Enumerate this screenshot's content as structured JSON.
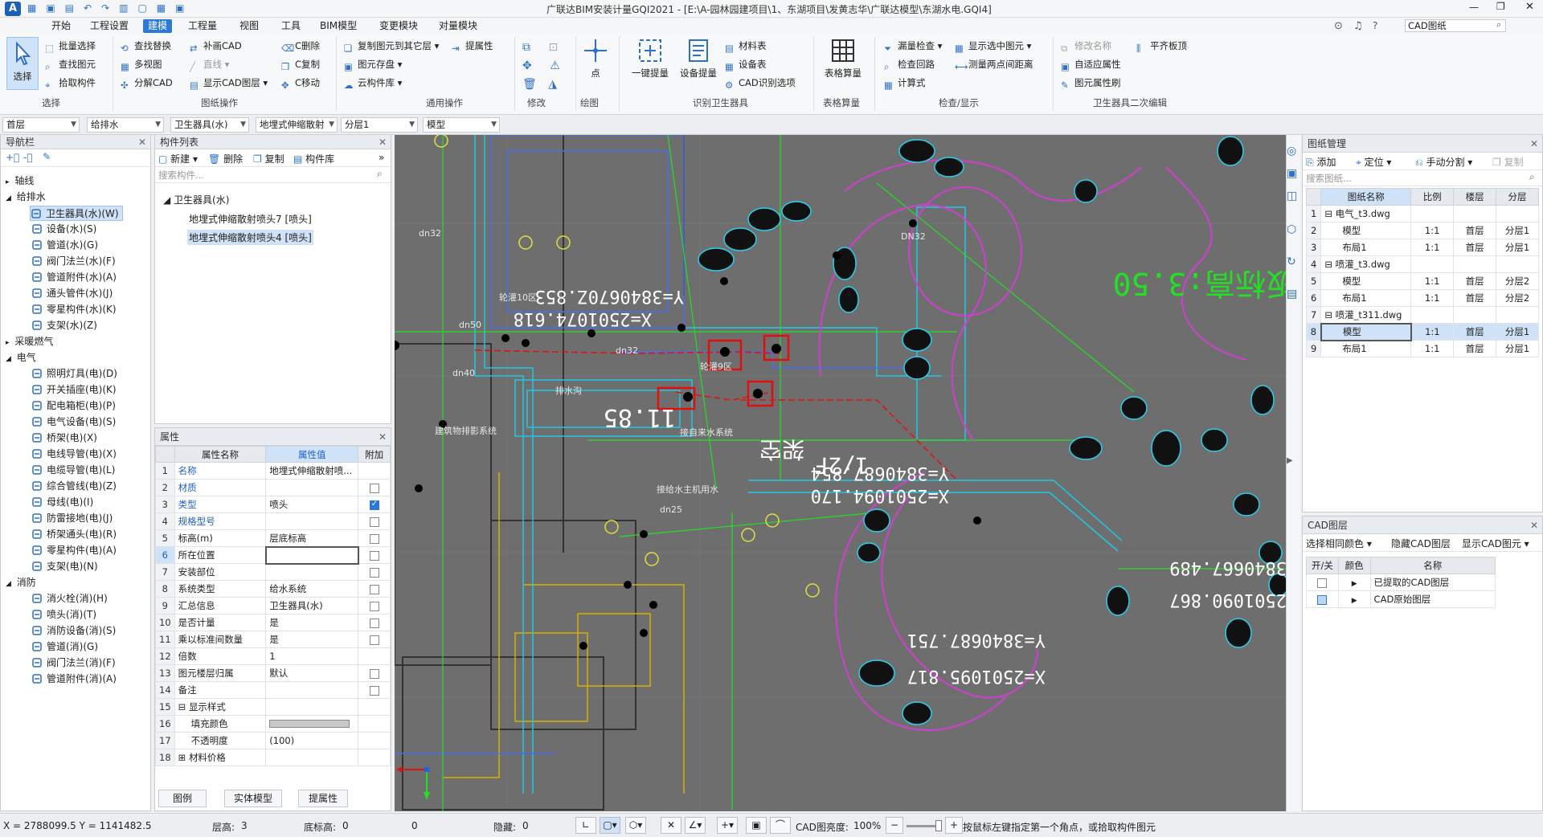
{
  "window": {
    "title": "广联达BIM安装计量GQI2021 - [E:\\A-园林园建项目\\1、东湖项目\\发黄志华\\广联达模型\\东湖水电.GQI4]",
    "search_placeholder": "CAD图纸"
  },
  "menu": [
    "开始",
    "工程设置",
    "建模",
    "工程量",
    "视图",
    "工具",
    "BIM模型",
    "变更模块",
    "对量模块"
  ],
  "active_menu": "建模",
  "ribbon": {
    "select_big": "选择",
    "groups": [
      {
        "label": "选择"
      },
      {
        "label": "图纸操作"
      },
      {
        "label": "通用操作"
      },
      {
        "label": "修改"
      },
      {
        "label": "绘图"
      },
      {
        "label": "识别卫生器具"
      },
      {
        "label": "表格算量"
      },
      {
        "label": "检查/显示"
      },
      {
        "label": "卫生器具二次编辑"
      }
    ],
    "select_items": [
      "批量选择",
      "查找图元",
      "拾取构件"
    ],
    "cad_col1": [
      "查找替换",
      "多视图",
      "分解CAD"
    ],
    "cad_col2": [
      "补画CAD",
      "直线",
      "显示CAD图层"
    ],
    "cad_col3": [
      "C删除",
      "C复制",
      "C移动"
    ],
    "common_items": [
      "复制图元到其它层",
      "提属性",
      "图元存盘",
      "云构件库"
    ],
    "draw_big": "点",
    "recog_big1": "一键提量",
    "recog_big2": "设备提量",
    "recog_items": [
      "材料表",
      "设备表",
      "CAD识别选项"
    ],
    "table_big": "表格算量",
    "check_items": [
      "漏量检查",
      "显示选中图元",
      "检查回路",
      "测量两点间距离",
      "计算式"
    ],
    "edit_items": [
      "修改名称",
      "平齐板顶",
      "自适应属性",
      "图元属性刷"
    ]
  },
  "filters": [
    "首层",
    "给排水",
    "卫生器具(水)",
    "地埋式伸缩散射",
    "分层1",
    "模型"
  ],
  "nav": {
    "title": "导航栏",
    "groups": [
      {
        "label": "轴线",
        "items": []
      },
      {
        "label": "给排水",
        "items": [
          "卫生器具(水)(W)",
          "设备(水)(S)",
          "管道(水)(G)",
          "阀门法兰(水)(F)",
          "管道附件(水)(A)",
          "通头管件(水)(J)",
          "零星构件(水)(K)",
          "支架(水)(Z)"
        ]
      },
      {
        "label": "采暖燃气",
        "items": []
      },
      {
        "label": "电气",
        "items": [
          "照明灯具(电)(D)",
          "开关插座(电)(K)",
          "配电箱柜(电)(P)",
          "电气设备(电)(S)",
          "桥架(电)(X)",
          "电线导管(电)(X)",
          "电缆导管(电)(L)",
          "综合管线(电)(Z)",
          "母线(电)(I)",
          "防雷接地(电)(J)",
          "桥架通头(电)(R)",
          "零星构件(电)(A)",
          "支架(电)(N)"
        ]
      },
      {
        "label": "消防",
        "items": [
          "消火栓(消)(H)",
          "喷头(消)(T)",
          "消防设备(消)(S)",
          "管道(消)(G)",
          "阀门法兰(消)(F)",
          "管道附件(消)(A)"
        ]
      }
    ],
    "selected": "卫生器具(水)(W)"
  },
  "component_list": {
    "title": "构件列表",
    "toolbar": [
      "新建",
      "删除",
      "复制",
      "构件库"
    ],
    "search_placeholder": "搜索构件...",
    "root": "卫生器具(水)",
    "items": [
      "地埋式伸缩散射喷头7 [喷头]",
      "地埋式伸缩散射喷头4 [喷头]"
    ],
    "selected": "地埋式伸缩散射喷头4 [喷头]"
  },
  "properties": {
    "title": "属性",
    "headers": [
      "属性名称",
      "属性值",
      "附加"
    ],
    "rows": [
      {
        "n": "1",
        "name": "名称",
        "value": "地埋式伸缩散射喷...",
        "blue": true,
        "cb": ""
      },
      {
        "n": "2",
        "name": "材质",
        "value": "",
        "blue": true,
        "cb": "off"
      },
      {
        "n": "3",
        "name": "类型",
        "value": "喷头",
        "blue": true,
        "cb": "on"
      },
      {
        "n": "4",
        "name": "规格型号",
        "value": "",
        "blue": true,
        "cb": "off"
      },
      {
        "n": "5",
        "name": "标高(m)",
        "value": "层底标高",
        "blue": false,
        "cb": "off"
      },
      {
        "n": "6",
        "name": "所在位置",
        "value": "",
        "blue": false,
        "cb": "off"
      },
      {
        "n": "7",
        "name": "安装部位",
        "value": "",
        "blue": false,
        "cb": "off"
      },
      {
        "n": "8",
        "name": "系统类型",
        "value": "给水系统",
        "blue": false,
        "cb": "off"
      },
      {
        "n": "9",
        "name": "汇总信息",
        "value": "卫生器具(水)",
        "blue": false,
        "cb": "off"
      },
      {
        "n": "10",
        "name": "是否计量",
        "value": "是",
        "blue": false,
        "cb": "off"
      },
      {
        "n": "11",
        "name": "乘以标准间数量",
        "value": "是",
        "blue": false,
        "cb": "off"
      },
      {
        "n": "12",
        "name": "倍数",
        "value": "1",
        "blue": false,
        "cb": ""
      },
      {
        "n": "13",
        "name": "图元楼层归属",
        "value": "默认",
        "blue": false,
        "cb": "off"
      },
      {
        "n": "14",
        "name": "备注",
        "value": "",
        "blue": false,
        "cb": "off"
      },
      {
        "n": "15",
        "name": "显示样式",
        "value": "",
        "blue": false,
        "cb": ""
      },
      {
        "n": "16",
        "name": "填充颜色",
        "value": "",
        "blue": false,
        "cb": ""
      },
      {
        "n": "17",
        "name": "不透明度",
        "value": "(100)",
        "blue": false,
        "cb": ""
      },
      {
        "n": "18",
        "name": "材料价格",
        "value": "",
        "blue": false,
        "cb": ""
      }
    ],
    "tabs": [
      "图例",
      "实体模型",
      "提属性"
    ]
  },
  "drawing_mgmt": {
    "title": "图纸管理",
    "toolbar": [
      "添加",
      "定位",
      "手动分割",
      "复制"
    ],
    "search_placeholder": "搜索图纸...",
    "headers": [
      "图纸名称",
      "比例",
      "楼层",
      "分层"
    ],
    "rows": [
      {
        "n": "1",
        "name": "电气_t3.dwg",
        "scale": "",
        "floor": "",
        "layer": "",
        "parent": true
      },
      {
        "n": "2",
        "name": "模型",
        "scale": "1:1",
        "floor": "首层",
        "layer": "分层1",
        "parent": false
      },
      {
        "n": "3",
        "name": "布局1",
        "scale": "1:1",
        "floor": "首层",
        "layer": "分层1",
        "parent": false
      },
      {
        "n": "4",
        "name": "喷灌_t3.dwg",
        "scale": "",
        "floor": "",
        "layer": "",
        "parent": true
      },
      {
        "n": "5",
        "name": "模型",
        "scale": "1:1",
        "floor": "首层",
        "layer": "分层2",
        "parent": false
      },
      {
        "n": "6",
        "name": "布局1",
        "scale": "1:1",
        "floor": "首层",
        "layer": "分层2",
        "parent": false
      },
      {
        "n": "7",
        "name": "喷灌_t311.dwg",
        "scale": "",
        "floor": "",
        "layer": "",
        "parent": true
      },
      {
        "n": "8",
        "name": "模型",
        "scale": "1:1",
        "floor": "首层",
        "layer": "分层1",
        "parent": false
      },
      {
        "n": "9",
        "name": "布局1",
        "scale": "1:1",
        "floor": "首层",
        "layer": "分层1",
        "parent": false
      }
    ],
    "selected_row": "8"
  },
  "cad_layers": {
    "title": "CAD图层",
    "toolbar": [
      "选择相同颜色",
      "隐藏CAD图层",
      "显示CAD图元"
    ],
    "headers": [
      "开/关",
      "颜色",
      "名称"
    ],
    "rows": [
      {
        "name": "已提取的CAD图层",
        "on": false
      },
      {
        "name": "CAD原始图层",
        "on": true
      }
    ]
  },
  "canvas_text": {
    "big_green": "楼板标高:3.50",
    "coord1": "Y=3840670Z.853",
    "coord2": "X=2501074.618",
    "coord3": "Y=3840687.854",
    "coord4": "X=2501094.170",
    "coord5": "3840667.489",
    "coord6": "2501090.867",
    "coord7": "Y=3840687.751",
    "coord8": "X=2501095.817",
    "elev": "11.85",
    "floor_label": "1/2F",
    "annot1": "接给水主机用水",
    "annot2": "接自来水系统",
    "annot3": "轮灌9区",
    "annot4": "轮灌10区",
    "annot5": "建筑物排影系统",
    "annot6": "排水沟",
    "annot7": "架空",
    "small_labels": [
      "dn32",
      "dn40",
      "dn50",
      "dn25",
      "DN32"
    ]
  },
  "status": {
    "coords": "X = 2788099.5 Y = 1141482.5",
    "floor_h_label": "层高:",
    "floor_h": "3",
    "base_label": "底标高:",
    "base": "0",
    "zero": "0",
    "hidden_label": "隐藏:",
    "hidden": "0",
    "cad_bright_label": "CAD图亮度:",
    "cad_bright": "100%",
    "hint": "按鼠标左键指定第一个角点，或拾取构件图元"
  },
  "colors": {
    "accent": "#2b78d6",
    "canvas_bg": "#6e6e6e",
    "highlight_red": "#e01010",
    "cad_green": "#22e022",
    "cad_magenta": "#d040d0"
  }
}
